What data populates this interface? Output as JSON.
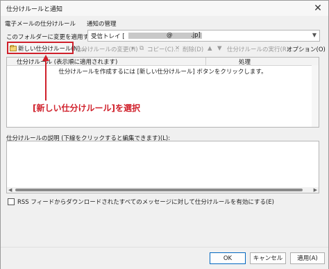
{
  "window": {
    "title": "仕分けルールと通知",
    "close_glyph": "✕"
  },
  "tabs": [
    {
      "label": "電子メールの仕分けルール"
    },
    {
      "label": "通知の管理"
    }
  ],
  "folder": {
    "label": "このフォルダーに変更を適用する(F):",
    "value_prefix": "受信トレイ [",
    "value_at": "@",
    "value_suffix": ".jp]"
  },
  "toolbar": {
    "new_rule": "新しい仕分けルール(N)...",
    "change_rule": "仕分けルールの変更(H)",
    "copy": "コピー(C)...",
    "delete": "削除(D)",
    "run_rules": "仕分けルールの実行(R)...",
    "options": "オプション(O)"
  },
  "rule_list": {
    "col_rule": "仕分けルール (表示順に適用されます)",
    "col_action": "処理",
    "empty_message": "仕分けルールを作成するには [新しい仕分けルール] ボタンをクリックします。"
  },
  "annotation": {
    "text": "[新しい仕分けルール]を選択",
    "color": "#d0202b"
  },
  "description": {
    "label": "仕分けルールの説明 (下線をクリックすると編集できます)(L):"
  },
  "rss": {
    "label": "RSS フィードからダウンロードされたすべてのメッセージに対して仕分けルールを有効にする(E)",
    "checked": false
  },
  "buttons": {
    "ok": "OK",
    "cancel": "キャンセル",
    "apply": "適用(A)"
  }
}
